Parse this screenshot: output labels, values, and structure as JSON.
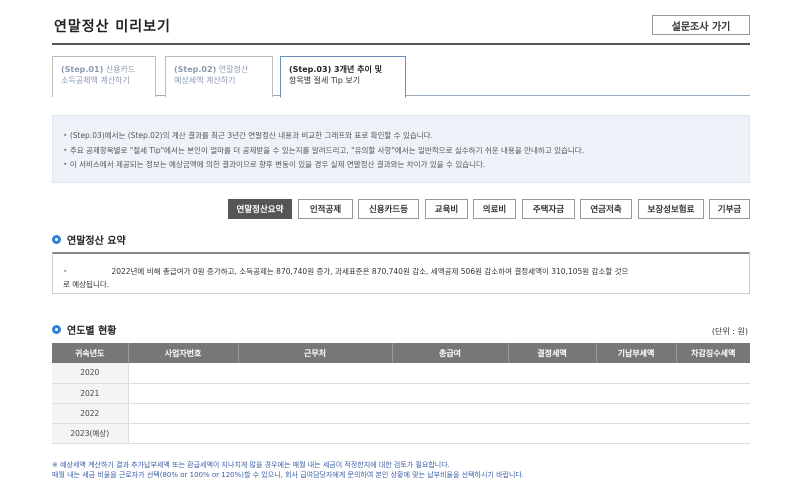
{
  "header": {
    "title": "연말정산 미리보기",
    "survey_button": "설문조사 가기"
  },
  "tabs": [
    {
      "step": "(Step.01)",
      "line1_rest": " 신용카드",
      "line2": "소득공제액 계산하기"
    },
    {
      "step": "(Step.02)",
      "line1_rest": " 연말정산",
      "line2": "예상세액 계산하기"
    },
    {
      "step": "(Step.03)",
      "line1_rest": " 3개년 추이 및",
      "line2": "항목별 절세 Tip 보기"
    }
  ],
  "info": {
    "lines": [
      "(Step.03)에서는 (Step.02)의 계산 결과를 최근 3년간 연말정산 내용과 비교한 그래프와 표로 확인할 수 있습니다.",
      "주요 공제항목별로 \"절세 Tip\"에서는 본인이 얼마를 더 공제받을 수 있는지를 알려드리고, \"유의할 사항\"에서는 일반적으로 실수하기 쉬운 내용을 안내하고 있습니다.",
      "이 서비스에서 제공되는 정보는 예상금액에 의한 결과이므로 향후 변동이 있을 경우 실제 연말정산 결과와는 차이가 있을 수 있습니다."
    ]
  },
  "categories": [
    "연말정산요약",
    "인적공제",
    "신용카드등",
    "교육비",
    "의료비",
    "주택자금",
    "연금저축",
    "보장성보험료",
    "기부금"
  ],
  "summary": {
    "title": "연말정산 요약",
    "bullet": "•",
    "line1": "2022년에 비해 총급여가 0원 증가하고, 소득공제는 870,740원 증가, 과세표준은 870,740원 감소, 세액공제 506원 감소하여 결정세액이 310,105원 감소할 것으",
    "line2": "로 예상됩니다."
  },
  "yearly": {
    "title": "연도별 현황",
    "unit": "(단위 : 원)",
    "columns": [
      "귀속년도",
      "사업자번호",
      "근무처",
      "총급여",
      "결정세액",
      "기납부세액",
      "차감징수세액"
    ],
    "rows": [
      "2020",
      "2021",
      "2022",
      "2023(예상)"
    ]
  },
  "notes": {
    "line1": "※ 예상세액 계산하기 결과 추가납부세액 또는 환급세액이 지나치게 많을 경우에는 매월 내는 세금이 적정한지에 대한 검토가 필요합니다.",
    "line2": "매월 내는 세금 비율을 근로자가 선택(80% or 100% or 120%)할 수 있으니, 회사 급여담당자에게 문의하여 본인 상황에 맞는 납부비율을 선택하시기 바랍니다."
  },
  "colors": {
    "accent": "#2f7fd6",
    "table_header": "#777777",
    "info_bg": "#eef3fa",
    "notes_text": "#3a5ea8"
  }
}
